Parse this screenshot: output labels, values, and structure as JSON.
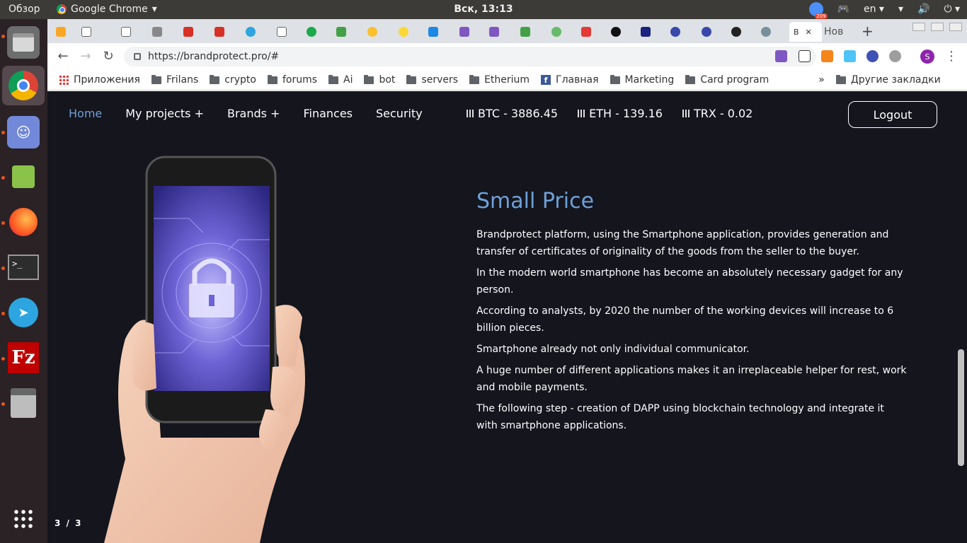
{
  "ubuntu": {
    "activities": "Обзор",
    "app_name": "Google Chrome",
    "clock": "Вск, 13:13",
    "badge_count": "209",
    "keyboard_layout": "en"
  },
  "chrome": {
    "active_tab_label": "B",
    "next_tab_label": "Нов",
    "url": "https://brandprotect.pro/#",
    "profile_initial": "S"
  },
  "bookmarks": [
    "Приложения",
    "Frilans",
    "crypto",
    "forums",
    "Ai",
    "bot",
    "servers",
    "Etherium",
    "Главная",
    "Marketing",
    "Card program",
    "Другие закладки"
  ],
  "site": {
    "nav": [
      "Home",
      "My projects +",
      "Brands +",
      "Finances",
      "Security"
    ],
    "prices": [
      "BTC - 3886.45",
      "ETH - 139.16",
      "TRX - 0.02"
    ],
    "logout": "Logout",
    "heading": "Small Price",
    "paragraphs": [
      "Brandprotect platform, using the Smartphone application, provides generation and transfer of certificates of originality of the goods from the seller to the buyer.",
      "In the modern world smartphone has become an absolutely necessary gadget for any person.",
      "According to analysts, by 2020 the number of the working devices will increase to 6 billion pieces.",
      "Smartphone already not only individual communicator.",
      "A huge number of different applications makes it an irreplaceable helper for rest, work and mobile payments.",
      "The following step - creation of DAPP using blockchain technology and integrate it with smartphone applications."
    ],
    "slide_counter": "3 / 3"
  },
  "colors": {
    "page_bg": "#14151d",
    "accent": "#6fa0d8",
    "dock_bg": "#2b2226",
    "ubuntu_orange": "#e95420"
  }
}
